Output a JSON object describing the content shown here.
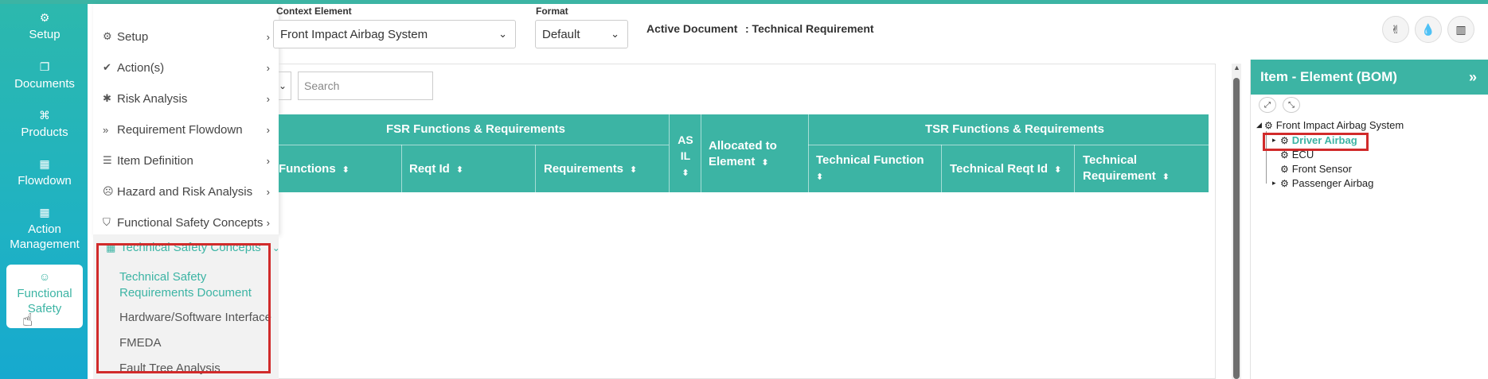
{
  "leftnav": {
    "items": [
      {
        "label": "Setup",
        "icon": "gears-icon"
      },
      {
        "label": "Documents",
        "icon": "documents-icon"
      },
      {
        "label": "Products",
        "icon": "products-icon"
      },
      {
        "label": "Flowdown",
        "icon": "building-icon"
      },
      {
        "label": "Action Management",
        "icon": "building-icon"
      },
      {
        "label": "Functional Safety",
        "icon": "smiley-icon"
      }
    ],
    "active": "Functional Safety"
  },
  "flyout": {
    "items": [
      {
        "label": "Setup",
        "icon": "gears-icon"
      },
      {
        "label": "Action(s)",
        "icon": "check-icon"
      },
      {
        "label": "Risk Analysis",
        "icon": "bug-icon"
      },
      {
        "label": "Requirement Flowdown",
        "icon": "double-chevron-down-icon"
      },
      {
        "label": "Item Definition",
        "icon": "list-icon"
      },
      {
        "label": "Hazard and Risk Analysis",
        "icon": "smiley-icon"
      },
      {
        "label": "Functional Safety Concepts",
        "icon": "shield-icon"
      }
    ],
    "expanded": {
      "label": "Technical Safety Concepts",
      "icon": "building-icon",
      "children": [
        "Technical Safety Requirements Document",
        "Hardware/Software Interface",
        "FMEDA",
        "Fault Tree Analysis"
      ]
    }
  },
  "form": {
    "context_label": "Context Element",
    "context_value": "Front Impact Airbag System",
    "format_label": "Format",
    "format_value": "Default",
    "active_doc_label": "Active Document",
    "active_doc_value": ": Technical Requirement"
  },
  "search": {
    "placeholder": "Search"
  },
  "table": {
    "group_fsr": "FSR Functions & Requirements",
    "group_tsr": "TSR Functions & Requirements",
    "col_functions": "Functions",
    "col_reqt_id": "Reqt Id",
    "col_requirements": "Requirements",
    "col_asil": "AS IL",
    "col_allocated": "Allocated to Element",
    "col_tech_function": "Technical Function",
    "col_tech_reqt_id": "Technical Reqt Id",
    "col_tech_requirement": "Technical Requirement"
  },
  "right_panel": {
    "title": "Item - Element (BOM)",
    "tree": [
      {
        "label": "Front Impact Airbag System",
        "level": 0,
        "expanded": true
      },
      {
        "label": "Driver Airbag",
        "level": 1,
        "selected": true
      },
      {
        "label": "ECU",
        "level": 1
      },
      {
        "label": "Front Sensor",
        "level": 1
      },
      {
        "label": "Passenger Airbag",
        "level": 1
      }
    ]
  },
  "colors": {
    "accent": "#3cb4a4",
    "highlight": "#d12b2b"
  }
}
